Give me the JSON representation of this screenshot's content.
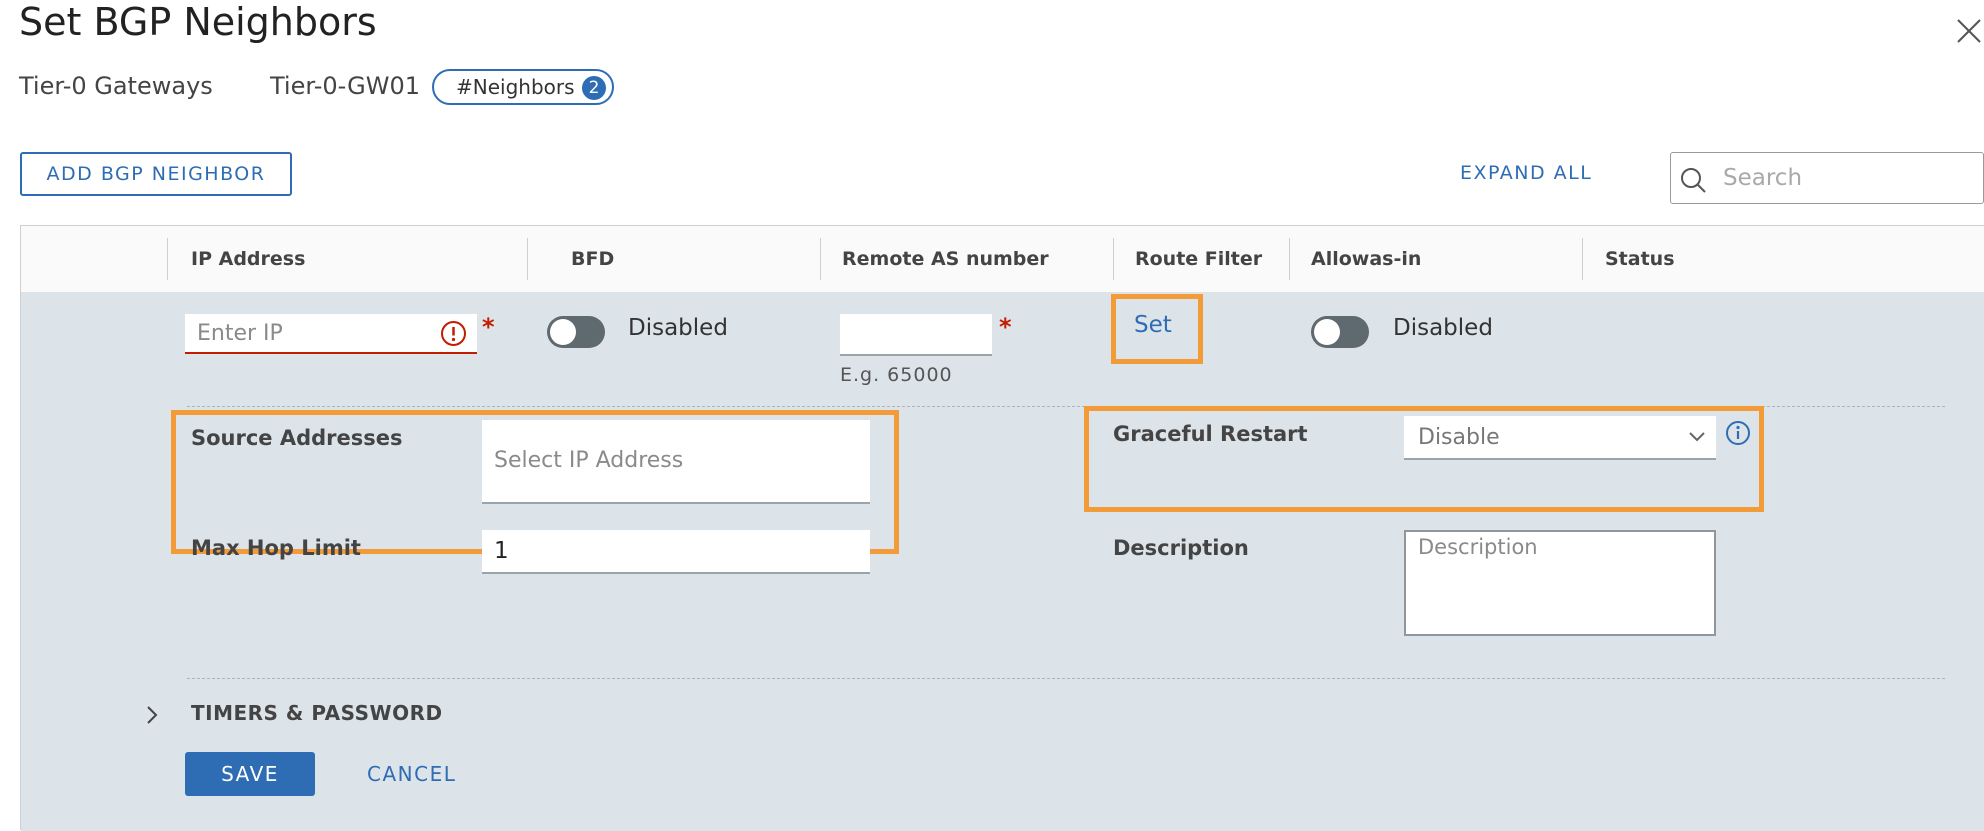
{
  "dialog": {
    "title": "Set BGP Neighbors",
    "close_icon": "close-icon"
  },
  "breadcrumb": {
    "items": [
      "Tier-0 Gateways",
      "Tier-0-GW01"
    ],
    "pill_label": "#Neighbors",
    "pill_count": "2"
  },
  "toolbar": {
    "add_label": "ADD BGP NEIGHBOR",
    "expand_label": "EXPAND ALL",
    "search_placeholder": "Search"
  },
  "table": {
    "columns": [
      "IP Address",
      "BFD",
      "Remote AS number",
      "Route Filter",
      "Allowas-in",
      "Status"
    ]
  },
  "row": {
    "ip_placeholder": "Enter IP",
    "required_mark": "*",
    "bfd_label": "Disabled",
    "remote_as_hint": "E.g. 65000",
    "route_filter_link": "Set",
    "allowas_label": "Disabled",
    "source_addresses_label": "Source Addresses",
    "source_addresses_placeholder": "Select IP Address",
    "max_hop_label": "Max Hop Limit",
    "max_hop_value": "1",
    "graceful_restart_label": "Graceful Restart",
    "graceful_restart_value": "Disable",
    "description_label": "Description",
    "description_placeholder": "Description",
    "timers_label": "TIMERS & PASSWORD",
    "save_label": "SAVE",
    "cancel_label": "CANCEL"
  },
  "colors": {
    "accent": "#2e6db4",
    "highlight": "#f29b38",
    "error": "#c21d00",
    "row_background": "#dce4ea"
  }
}
